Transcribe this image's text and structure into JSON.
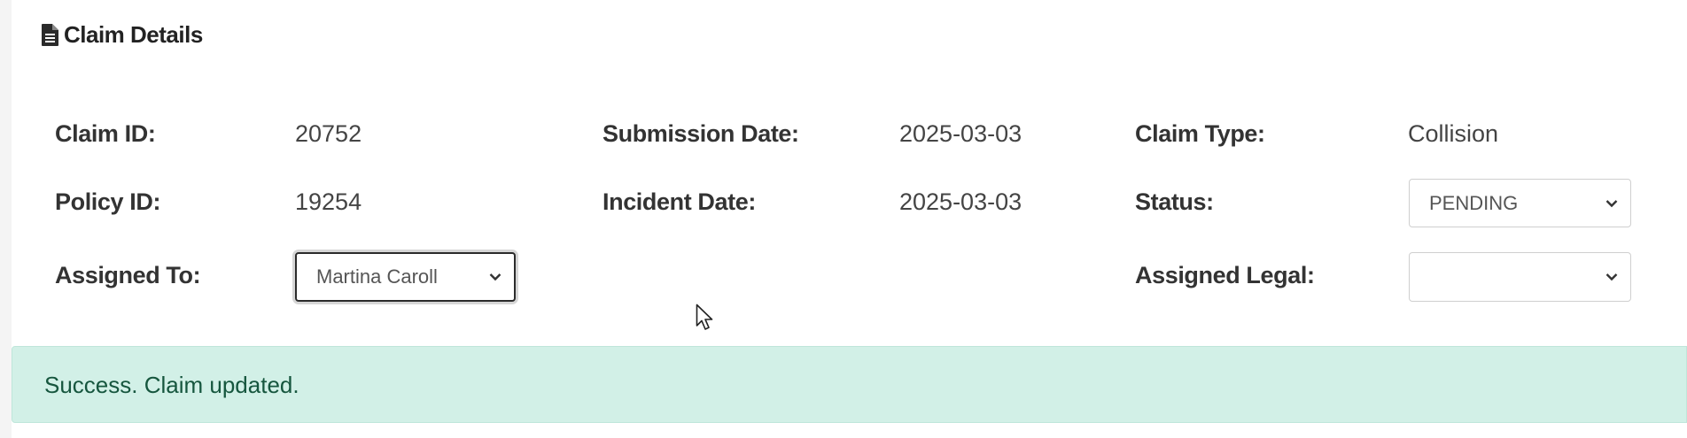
{
  "header": {
    "title": "Claim Details",
    "icon": "file-document-icon"
  },
  "fields": {
    "claim_id": {
      "label": "Claim ID:",
      "value": "20752"
    },
    "policy_id": {
      "label": "Policy ID:",
      "value": "19254"
    },
    "assigned_to": {
      "label": "Assigned To:",
      "value": "Martina Caroll"
    },
    "submission_date": {
      "label": "Submission Date:",
      "value": "2025-03-03"
    },
    "incident_date": {
      "label": "Incident Date:",
      "value": "2025-03-03"
    },
    "claim_type": {
      "label": "Claim Type:",
      "value": "Collision"
    },
    "status": {
      "label": "Status:",
      "value": "PENDING"
    },
    "assigned_legal": {
      "label": "Assigned Legal:",
      "value": ""
    }
  },
  "alert": {
    "message": "Success. Claim updated.",
    "type": "success",
    "color": "#d2f0e7"
  }
}
